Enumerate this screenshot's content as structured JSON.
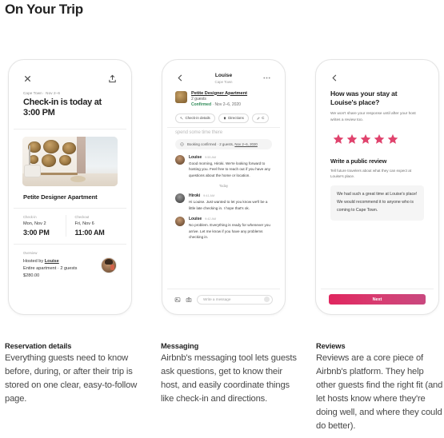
{
  "page": {
    "title": "On Your Trip"
  },
  "colors": {
    "accent": "#E0436D",
    "button_start": "#E0265F",
    "button_end": "#C9487F",
    "confirmed_green": "#2E8B57"
  },
  "phone1": {
    "close_icon": "close-icon",
    "share_icon": "share-icon",
    "subheader": "Cape Town · Nov 2–6",
    "title": "Check-in is today at 3:00 PM",
    "photo_alt": "living room with woven wall baskets",
    "listing_name": "Petite Designer Apartment",
    "checkin_label": "Check-in",
    "checkin_date": "Mon, Nov 2",
    "checkin_time": "3:00 PM",
    "checkout_label": "Checkout",
    "checkout_date": "Fri, Nov 6",
    "checkout_time": "11:00 AM",
    "overview_label": "Overview",
    "hosted_prefix": "Hosted by ",
    "host_name": "Louise",
    "details_line": "Entire apartment · 2 guests",
    "price": "$280.00"
  },
  "phone2": {
    "back_icon": "chevron-left-icon",
    "more_icon": "more-options-icon",
    "header_name": "Louise",
    "header_sub": "Cape Town",
    "listing_name": "Petite Designer Apartment",
    "listing_guests": "2 guests",
    "status": "Confirmed",
    "status_dates": " · Nov 2–6, 2020",
    "chips": [
      {
        "label": "Check-in details",
        "icon": "key-icon"
      },
      {
        "label": "Directions",
        "icon": "pin-icon"
      },
      {
        "label": "C",
        "icon": "pencil-icon"
      }
    ],
    "faded_line": "spend some time there",
    "banner_icon": "booking-icon",
    "banner_text": "Booking confirmed · 2 guests, ",
    "banner_link": "Nov 2–6, 2020",
    "today_divider": "Today",
    "messages": [
      {
        "sender": "Louise",
        "time": "9:55 AM",
        "avatar": "louise-avatar",
        "text": "Good morning, Hiroki. We're looking forward to hosting you. Feel free to reach out if you have any questions about the home or location."
      },
      {
        "sender": "Hiroki",
        "time": "9:41 AM",
        "avatar": "hiroki-avatar",
        "text": "Hi Louise. Just wanted to let you know we'll be a little late checking in. I hope that's ok."
      },
      {
        "sender": "Louise",
        "time": "9:42 AM",
        "avatar": "louise-avatar",
        "text": "No problem. Everything is ready for whenever you arrive. Let me know if you have any problems checking in."
      }
    ],
    "compose": {
      "photo_icon": "photo-icon",
      "camera_icon": "camera-icon",
      "placeholder": "Write a message",
      "send_icon": "send-icon"
    }
  },
  "phone3": {
    "back_icon": "chevron-left-icon",
    "question": "How was your stay at Louise's place?",
    "note": "We won't share your response until after your host writes a review too.",
    "rating": 5,
    "max_rating": 5,
    "review_heading": "Write a public review",
    "review_note": "Tell future travelers about what they can expect at Louise's place.",
    "review_text": "We had such a great time at Louise's place! We would recommend it to anyone who is coming to Cape Town.",
    "next_label": "Next"
  },
  "captions": [
    {
      "heading": "Reservation details",
      "body": "Everything guests need to know before, during, or after their trip is stored on one clear, easy-to-follow page."
    },
    {
      "heading": "Messaging",
      "body": "Airbnb's messaging tool lets guests ask questions, get to know their host, and easily coordinate things like check-in and directions."
    },
    {
      "heading": "Reviews",
      "body": "Reviews are a core piece of Airbnb's platform. They help other guests find the right fit (and let hosts know where they're doing well, and where they could do better)."
    }
  ]
}
